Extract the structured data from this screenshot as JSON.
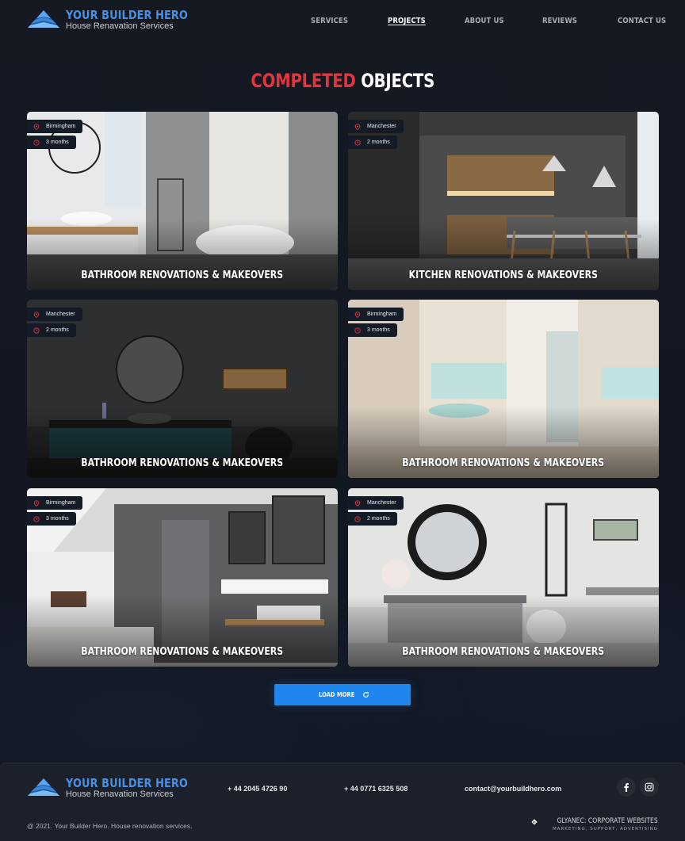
{
  "brand": {
    "title": "YOUR BUILDER HERO",
    "subtitle": "House Renavation Services"
  },
  "nav": {
    "items": [
      {
        "label": "SERVICES",
        "active": false
      },
      {
        "label": "PROJECTS",
        "active": true
      },
      {
        "label": "ABOUT US",
        "active": false
      },
      {
        "label": "REVIEWS",
        "active": false
      },
      {
        "label": "CONTACT US",
        "active": false
      }
    ]
  },
  "section": {
    "title_accent": "COMPLETED",
    "title_rest": "OBJECTS"
  },
  "projects": [
    {
      "location": "Birmingham",
      "duration": "3 months",
      "title": "BATHROOM RENOVATIONS & MAKEOVERS",
      "scene": "bright-bathroom"
    },
    {
      "location": "Manchester",
      "duration": "2 months",
      "title": "KITCHEN RENOVATIONS & MAKEOVERS",
      "scene": "dark-kitchen"
    },
    {
      "location": "Manchester",
      "duration": "2 months",
      "title": "BATHROOM RENOVATIONS & MAKEOVERS",
      "scene": "dark-bathroom"
    },
    {
      "location": "Birmingham",
      "duration": "3 months",
      "title": "BATHROOM RENOVATIONS & MAKEOVERS",
      "scene": "beige-bathroom"
    },
    {
      "location": "Birmingham",
      "duration": "3 months",
      "title": "BATHROOM RENOVATIONS & MAKEOVERS",
      "scene": "grey-tile-bathroom"
    },
    {
      "location": "Manchester",
      "duration": "2 months",
      "title": "BATHROOM RENOVATIONS & MAKEOVERS",
      "scene": "marble-bathroom"
    }
  ],
  "load_more": {
    "label": "LOAD MORE",
    "icon": "refresh-icon"
  },
  "footer": {
    "phone_1": "+ 44 2045 4726 90",
    "phone_2": "+ 44 0771 6325 508",
    "email": "contact@yourbuildhero.com",
    "social": [
      "facebook-icon",
      "instagram-icon"
    ],
    "copyright": "@ 2021. Your Builder Hero. House renovation services.",
    "credit_title": "GLYANEC: CORPORATE WEBSITES",
    "credit_sub": "MARKETING, SUPPORT, ADVERTISING"
  },
  "colors": {
    "accent_blue": "#1f86f0",
    "brand_blue": "#4a90e2",
    "accent_red": "#e3343c",
    "background": "#141823"
  }
}
